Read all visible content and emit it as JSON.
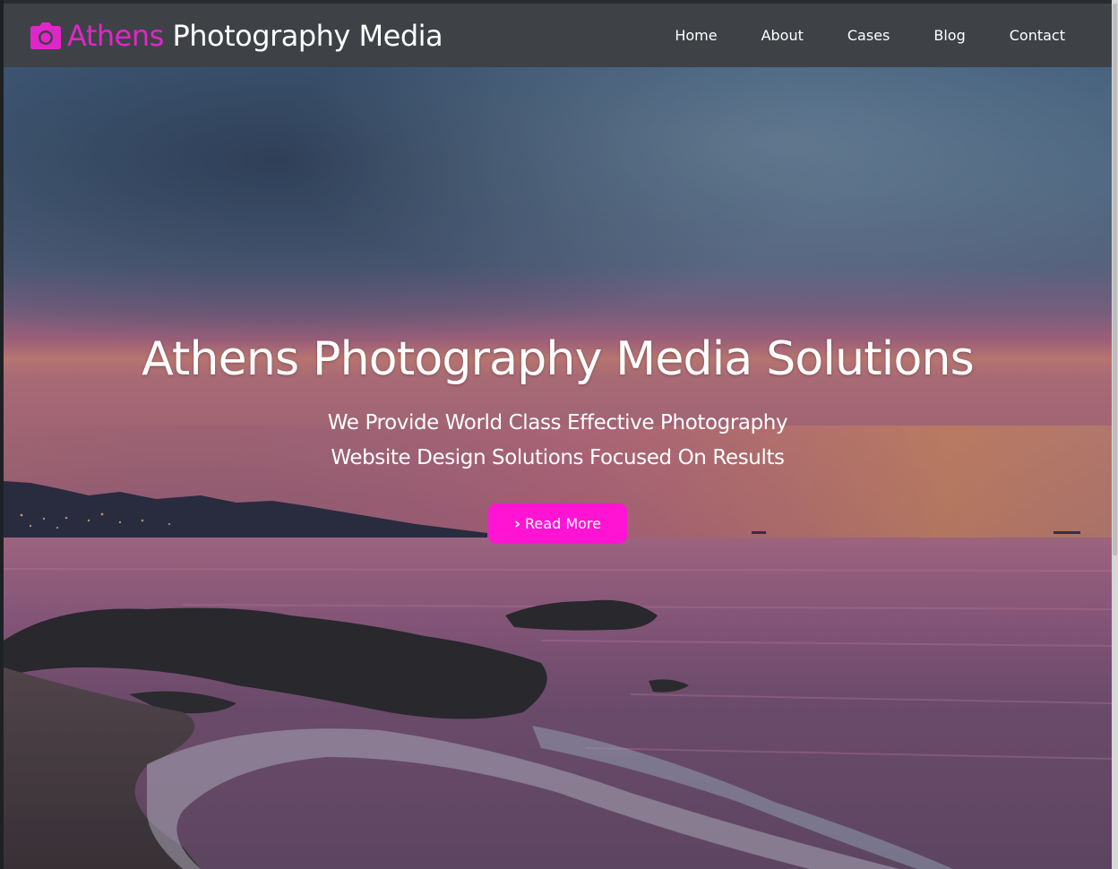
{
  "brand": {
    "accent_text": "Athens",
    "rest_text": " Photography Media",
    "accent_color": "#e026c9",
    "icon": "camera-icon"
  },
  "nav": {
    "items": [
      {
        "label": "Home"
      },
      {
        "label": "About"
      },
      {
        "label": "Cases"
      },
      {
        "label": "Blog"
      },
      {
        "label": "Contact"
      }
    ]
  },
  "hero": {
    "title": "Athens Photography Media Solutions",
    "subtitle_line1": "We Provide World Class Effective Photography",
    "subtitle_line2": "Website Design Solutions Focused On Results",
    "cta_label": "Read More",
    "cta_icon": "chevron-right-icon",
    "cta_color": "#ff14d4"
  }
}
